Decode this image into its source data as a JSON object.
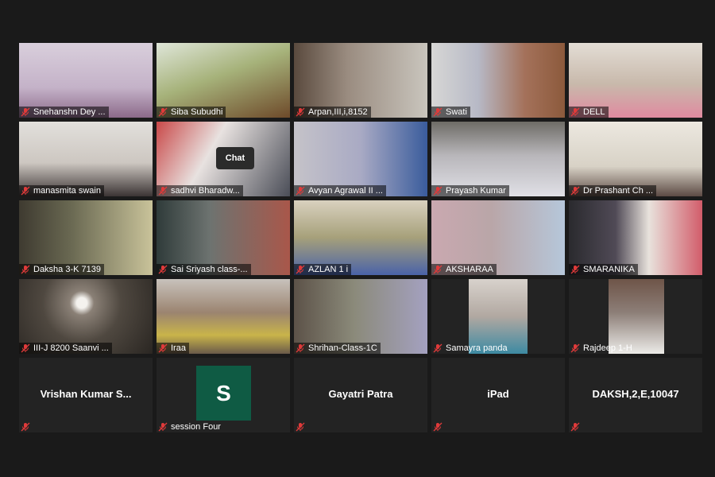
{
  "participants": [
    {
      "name": "Snehanshn  Dey ...",
      "avatar_letter": "",
      "tone": "#c9b7c9"
    },
    {
      "name": "Siba Subudhi",
      "avatar_letter": "",
      "tone": "#8fa35a"
    },
    {
      "name": "Arpan,III,i,8152",
      "avatar_letter": "",
      "tone": "#7b7064"
    },
    {
      "name": "Swati",
      "avatar_letter": "",
      "tone": "#b89a86"
    },
    {
      "name": "DELL",
      "avatar_letter": "",
      "tone": "#cdbfb5"
    },
    {
      "name": "manasmita swain",
      "avatar_letter": "",
      "tone": "#c7c2bd"
    },
    {
      "name": "sadhvi Bharadw...",
      "avatar_letter": "",
      "tone": "#8a6a6a"
    },
    {
      "name": "Avyan Agrawal II ...",
      "avatar_letter": "",
      "tone": "#a9aac4"
    },
    {
      "name": "Prayash Kumar",
      "avatar_letter": "",
      "tone": "#9d9da6"
    },
    {
      "name": "Dr Prashant Ch ...",
      "avatar_letter": "",
      "tone": "#d8d2c6"
    },
    {
      "name": "Daksha 3-K 7139",
      "avatar_letter": "",
      "tone": "#6b6a53"
    },
    {
      "name": "Sai Sriyash class-...",
      "avatar_letter": "",
      "tone": "#7a5c55"
    },
    {
      "name": "AZLAN 1 i",
      "avatar_letter": "",
      "tone": "#a6a07a"
    },
    {
      "name": "AKSHARAA",
      "avatar_letter": "",
      "tone": "#b9a6a8"
    },
    {
      "name": "SMARANIKA",
      "avatar_letter": "",
      "tone": "#cfc7c6"
    },
    {
      "name": "III-J 8200 Saanvi ...",
      "avatar_letter": "",
      "tone": "#4f4840"
    },
    {
      "name": "Iraa",
      "avatar_letter": "",
      "tone": "#9b8470"
    },
    {
      "name": "Shrihan-Class-1C",
      "avatar_letter": "",
      "tone": "#8b8a7a"
    },
    {
      "name": "Samayra panda",
      "avatar_letter": "",
      "tone": "#b1a8a1"
    },
    {
      "name": "Rajdeep 1-H",
      "avatar_letter": "",
      "tone": "#8d7f78"
    },
    {
      "name": "Vrishan Kumar S...",
      "avatar_letter": "",
      "tone": ""
    },
    {
      "name": "session Four",
      "avatar_letter": "S",
      "tone": ""
    },
    {
      "name": "Gayatri Patra",
      "avatar_letter": "",
      "tone": ""
    },
    {
      "name": "iPad",
      "avatar_letter": "",
      "tone": ""
    },
    {
      "name": "DAKSH,2,E,10047",
      "avatar_letter": "",
      "tone": ""
    }
  ],
  "chat_tooltip": "Chat",
  "colors": {
    "background": "#1a1a1a",
    "tile_empty": "#232323",
    "avatar_bg": "#0f5b44",
    "muted_icon": "#e03a3a"
  },
  "icons": {
    "muted": "microphone-muted-icon"
  }
}
